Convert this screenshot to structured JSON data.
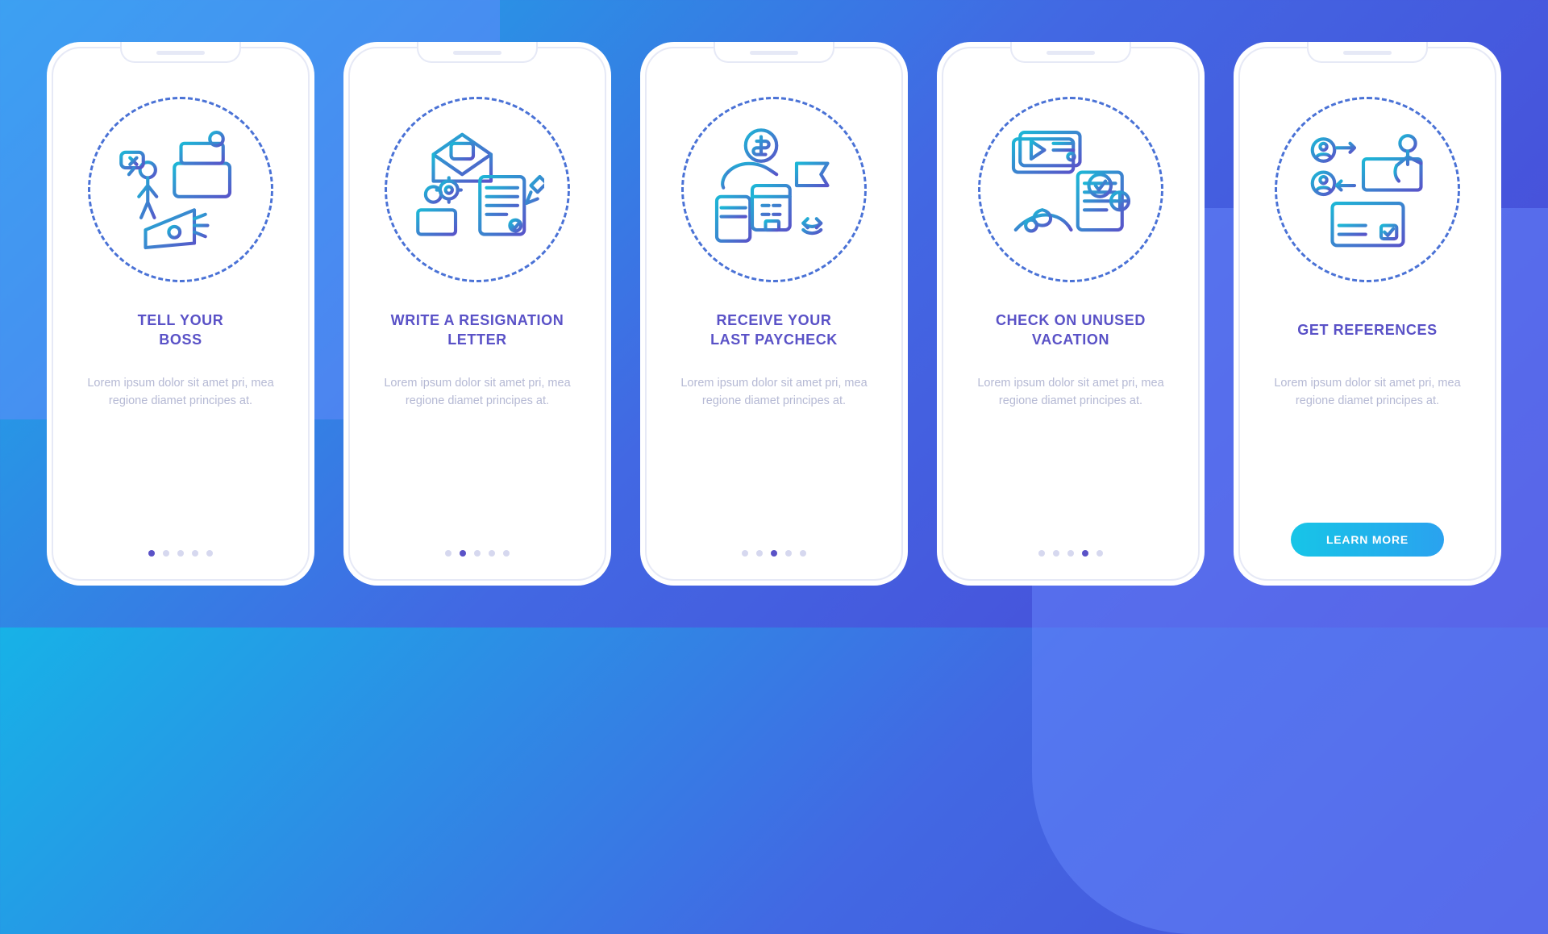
{
  "placeholder_body": "Lorem ipsum dolor sit amet pri, mea regione diamet principes at.",
  "cta_label": "LEARN MORE",
  "total_slides": 5,
  "colors": {
    "accent": "#5a52c7",
    "icon_stroke_start": "#1cb7d6",
    "icon_stroke_end": "#5854c9",
    "cta_gradient_start": "#17c5e7",
    "cta_gradient_end": "#2aa2ef"
  },
  "screens": [
    {
      "title": "TELL YOUR\nBOSS",
      "icon": "tell-boss-icon",
      "active_index": 0,
      "has_cta": false
    },
    {
      "title": "WRITE A RESIGNATION\nLETTER",
      "icon": "resignation-icon",
      "active_index": 1,
      "has_cta": false
    },
    {
      "title": "RECEIVE YOUR\nLAST PAYCHECK",
      "icon": "paycheck-icon",
      "active_index": 2,
      "has_cta": false
    },
    {
      "title": "CHECK ON UNUSED\nVACATION",
      "icon": "vacation-icon",
      "active_index": 3,
      "has_cta": false
    },
    {
      "title": "GET REFERENCES",
      "icon": "references-icon",
      "active_index": 4,
      "has_cta": true
    }
  ]
}
